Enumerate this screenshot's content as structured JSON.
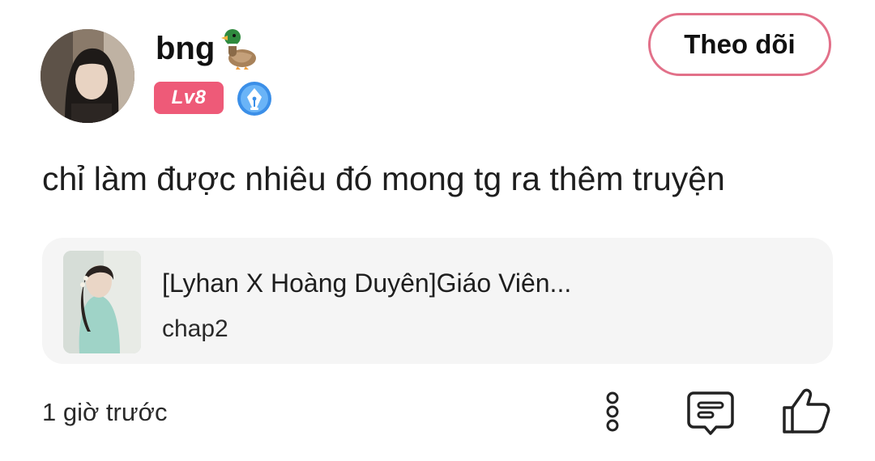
{
  "user": {
    "name": "bng",
    "name_emoji": "duck-emoji",
    "level": "Lv8",
    "badge_icon": "pen-nib-badge-icon",
    "avatar_icon": "avatar-photo"
  },
  "follow": {
    "label": "Theo dõi",
    "border_color": "#e27089"
  },
  "comment": {
    "text": "chỉ làm được nhiêu đó mong tg ra thêm truyện"
  },
  "story": {
    "title": "[Lyhan X Hoàng Duyên]Giáo Viên...",
    "chapter": "chap2",
    "thumbnail_icon": "story-cover-image"
  },
  "meta": {
    "timestamp": "1 giờ trước"
  },
  "actions": {
    "more_icon": "more-vertical-icon",
    "comment_icon": "comment-icon",
    "like_icon": "thumbs-up-icon"
  },
  "colors": {
    "level_badge": "#ee5a78",
    "card_background": "#f5f5f5",
    "pen_badge": "#3b8fe8"
  }
}
